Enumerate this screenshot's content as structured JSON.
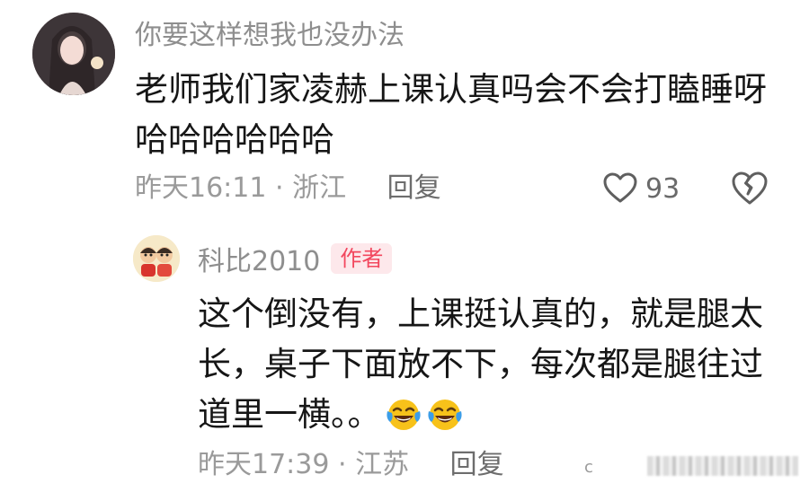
{
  "main_comment": {
    "username": "你要这样想我也没办法",
    "text": "老师我们家凌赫上课认真吗会不会打瞌睡呀哈哈哈哈哈哈",
    "time": "昨天16:11",
    "separator": "·",
    "location": "浙江",
    "reply_label": "回复",
    "like_count": "93",
    "avatar_icon": "user-avatar-photo",
    "like_icon": "heart-outline-icon",
    "dislike_icon": "broken-heart-icon"
  },
  "reply_comment": {
    "username": "科比2010",
    "badge": "作者",
    "text": "这个倒没有，上课挺认真的，就是腿太长，桌子下面放不下，每次都是腿往过道里一横。。",
    "emoji_icon": "laughing-tears-emoji",
    "time": "昨天17:39",
    "separator": "·",
    "location": "江苏",
    "reply_label": "回复",
    "avatar_icon": "cartoon-avatar"
  },
  "footer": {
    "mark": "c"
  },
  "colors": {
    "text_primary": "#161616",
    "text_secondary": "#8e8e8e",
    "badge_text": "#f2475e",
    "badge_bg": "#fde8eb",
    "emoji_yellow": "#f7c21a"
  }
}
